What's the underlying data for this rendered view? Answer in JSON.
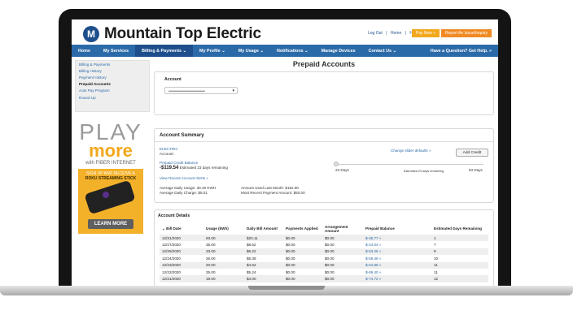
{
  "header": {
    "brand": "Mountain Top Electric",
    "logo_letter": "M",
    "top_links": [
      "Log Out",
      "|",
      "Home",
      "|",
      "Help"
    ],
    "pay_now": "Pay Now »",
    "report_outage": "Report An Issue/Inquiry"
  },
  "nav": {
    "items": [
      "Home",
      "My Services",
      "Billing & Payments ⌄",
      "My Profile ⌄",
      "My Usage ⌄",
      "Notifications ⌄",
      "Manage Devices",
      "Contact Us ⌄"
    ],
    "active_index": 2,
    "help": "Have a Question? Get Help. »"
  },
  "sidebar": {
    "items": [
      "Billing & Payments",
      "Billing History",
      "Payment History",
      "Prepaid Accounts",
      "Auto Pay Program",
      "Round Up"
    ],
    "active_index": 3
  },
  "promo": {
    "play": "PLAY",
    "more": "more",
    "with": "with FIBER INTERNET",
    "line1": "SIGN UP AND RECEIVE A",
    "line2": "ROKU STREAMING STICK",
    "cta": "LEARN MORE"
  },
  "page": {
    "title": "Prepaid Accounts",
    "account_label": "Account"
  },
  "summary": {
    "heading": "Account Summary",
    "service": "ELECTRIC",
    "account_label": "Account:",
    "change_slider": "Change slider defaults »",
    "add_credit": "Add Credit",
    "prepaid_balance_label": "Prepaid Credit Balance",
    "balance_value": "-$119.54",
    "balance_note": "Estimated 23 days remaining",
    "slider_left": "23 Days",
    "slider_mid": "Estimated 23 days remaining",
    "slider_right": "53 Days",
    "alerts_link": "View Recent Account Alerts »",
    "avg_usage": "Average Daily Usage: 30.49 KWH",
    "avg_charge": "Average Daily Charge: $5.01",
    "amount_last_month": "Amount Used Last Month: $192.90",
    "recent_payment": "Most Recent Payment Amount: $50.00"
  },
  "details": {
    "heading": "Account Details",
    "columns": [
      "⌄  Bill Date",
      "Usage (kWh)",
      "Daily Bill Amount",
      "Payments Applied",
      "Arrangement Amount",
      "Prepaid Balance",
      "Estimated Days Remaining"
    ],
    "rows": [
      [
        "12/31/2020",
        "93.00",
        "$20.11",
        "$0.00",
        "$0.00",
        "$-36.77 »",
        "1"
      ],
      [
        "12/27/2020",
        "35.00",
        "$8.62",
        "$0.00",
        "$0.00",
        "$-44.04 »",
        "7"
      ],
      [
        "12/25/2020",
        "33.00",
        "$6.22",
        "$0.00",
        "$0.00",
        "$-53.26 »",
        "9"
      ],
      [
        "12/24/2020",
        "26.00",
        "$5.38",
        "$0.00",
        "$0.00",
        "$-58.48 »",
        "10"
      ],
      [
        "12/23/2020",
        "20.00",
        "$4.62",
        "$0.00",
        "$0.00",
        "$-64.88 »",
        "11"
      ],
      [
        "12/22/2020",
        "25.00",
        "$5.24",
        "$0.00",
        "$0.00",
        "$-69.40 »",
        "11"
      ],
      [
        "12/21/2020",
        "19.00",
        "$4.00",
        "$0.00",
        "$0.00",
        "$-74.72 »",
        "12"
      ]
    ]
  }
}
